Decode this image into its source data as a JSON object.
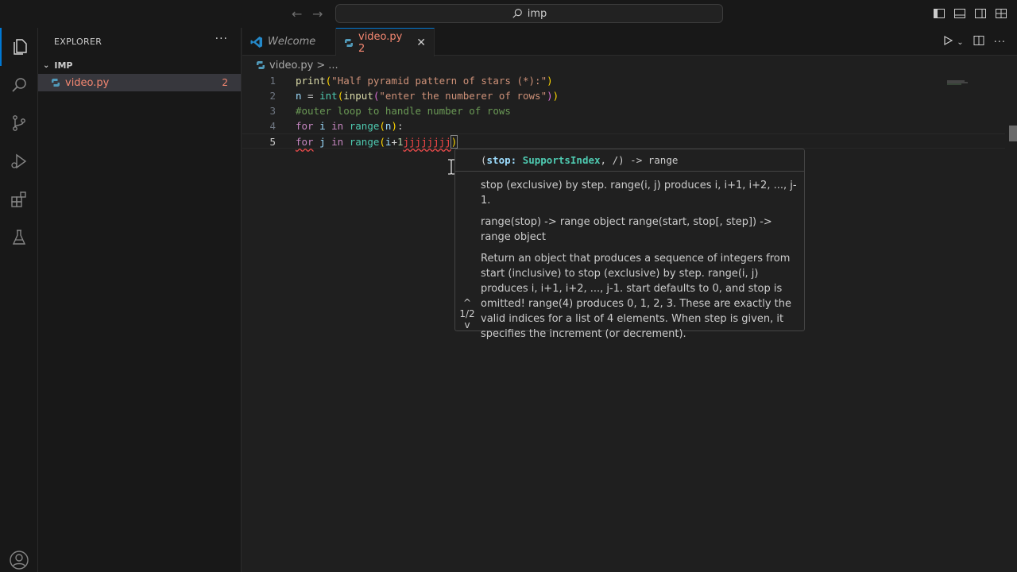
{
  "titlebar": {
    "search_text": "imp",
    "back_icon": "arrow-left-icon",
    "forward_icon": "arrow-right-icon"
  },
  "activitybar": {
    "items": [
      "files-icon",
      "search-icon",
      "source-control-icon",
      "run-debug-icon",
      "extensions-icon",
      "testing-icon"
    ],
    "account_icon": "account-icon"
  },
  "sidebar": {
    "title": "EXPLORER",
    "more": "···",
    "folder": "IMP",
    "file": {
      "name": "video.py",
      "problems": "2"
    }
  },
  "tabs": [
    {
      "label": "Welcome"
    },
    {
      "label": "video.py 2",
      "close": "✕"
    }
  ],
  "breadcrumb": {
    "file": "video.py",
    "sep": ">",
    "rest": "..."
  },
  "editor": {
    "line_numbers": [
      "1",
      "2",
      "3",
      "4",
      "5"
    ],
    "lines": {
      "l1": {
        "fn": "print",
        "open": "(",
        "str": "\"Half pyramid pattern of stars (*):\"",
        "close": ")"
      },
      "l2": {
        "var": "n",
        "eq": " = ",
        "cls": "int",
        "open1": "(",
        "fn": "input",
        "open2": "(",
        "str": "\"enter the numberer of rows\"",
        "close2": ")",
        "close1": ")"
      },
      "l3": {
        "comment": "#outer loop to handle number of rows"
      },
      "l4": {
        "kw": "for",
        "var": " i ",
        "in": "in",
        "fn": " range",
        "open": "(",
        "arg": "n",
        "close": ")",
        "colon": ":"
      },
      "l5": {
        "kw": "for",
        "var": " j ",
        "in": "in",
        "fn": " range",
        "open": "(",
        "arg": "i",
        "plus": "+",
        "num": "1",
        "err": "jjjjjjjj",
        "close": ")"
      }
    }
  },
  "hover": {
    "sig_open": "(",
    "sig_param": "stop",
    "sig_colon": ": ",
    "sig_type": "SupportsIndex",
    "sig_rest": ", /) -> range",
    "p1": "stop (exclusive) by step. range(i, j) produces i, i+1, i+2, ..., j-1.",
    "p2": "range(stop) -> range object range(start, stop[, step]) -> range object",
    "p3": "Return an object that produces a sequence of integers from start (inclusive) to stop (exclusive) by step. range(i, j) produces i, i+1, i+2, ..., j-1. start defaults to 0, and stop is omitted! range(4) produces 0, 1, 2, 3. These are exactly the valid indices for a list of 4 elements. When step is given, it specifies the increment (or decrement).",
    "nav_up": "^",
    "nav_count": "1/2",
    "nav_down": "v"
  },
  "colors": {
    "accent": "#0078d4",
    "error": "#f48771",
    "background": "#1f1f1f"
  }
}
